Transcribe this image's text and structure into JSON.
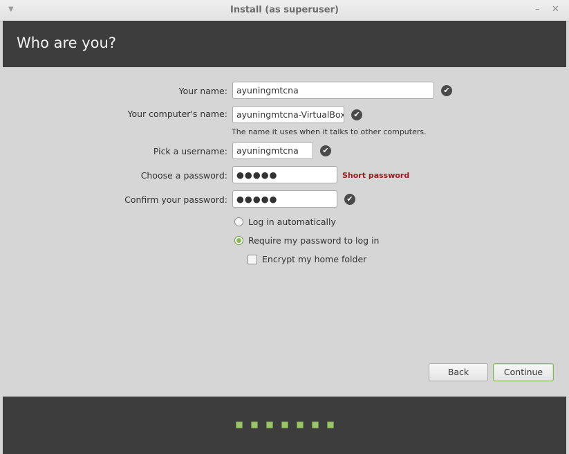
{
  "window": {
    "title": "Install (as superuser)",
    "menu_icon": "chevron-down-icon",
    "minimize_icon": "minimize-icon",
    "close_icon": "close-icon"
  },
  "header": {
    "page_title": "Who are you?"
  },
  "form": {
    "name_label": "Your name:",
    "name_value": "ayuningmtcna",
    "computer_label": "Your computer's name:",
    "computer_value": "ayuningmtcna-VirtualBox",
    "computer_hint": "The name it uses when it talks to other computers.",
    "username_label": "Pick a username:",
    "username_value": "ayuningmtcna",
    "password_label": "Choose a password:",
    "password_value": "●●●●●",
    "password_warning": "Short password",
    "confirm_label": "Confirm your password:",
    "confirm_value": "●●●●●"
  },
  "options": {
    "login_auto": "Log in automatically",
    "require_password": "Require my password to log in",
    "encrypt_home": "Encrypt my home folder",
    "selected": "require_password",
    "encrypt_checked": false
  },
  "buttons": {
    "back": "Back",
    "continue": "Continue"
  },
  "progress": {
    "total_steps": 7
  },
  "colors": {
    "accent": "#8bb65a",
    "header_bg": "#3d3d3d",
    "warning": "#9b1c1c"
  }
}
